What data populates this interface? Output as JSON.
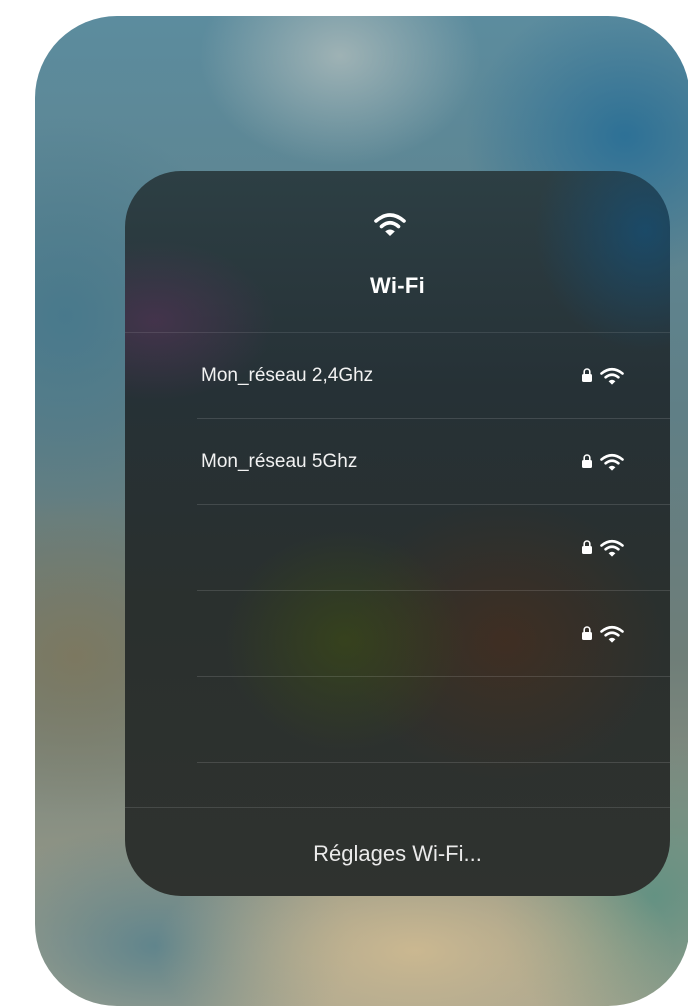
{
  "header": {
    "icon": "wifi-icon",
    "title": "Wi-Fi"
  },
  "networks": [
    {
      "name": "Mon_réseau 2,4Ghz",
      "locked": true,
      "signal_icon": "wifi-signal-icon"
    },
    {
      "name": "Mon_réseau 5Ghz",
      "locked": true,
      "signal_icon": "wifi-signal-icon"
    },
    {
      "name": "",
      "locked": true,
      "signal_icon": "wifi-signal-icon"
    },
    {
      "name": "",
      "locked": true,
      "signal_icon": "wifi-signal-icon"
    },
    {
      "name": "",
      "locked": false
    },
    {
      "name": "",
      "locked": false
    }
  ],
  "footer": {
    "settings_label": "Réglages Wi-Fi..."
  },
  "colors": {
    "text": "#ffffff",
    "panel": "#2a3236",
    "divider": "rgba(255,255,255,0.13)"
  }
}
